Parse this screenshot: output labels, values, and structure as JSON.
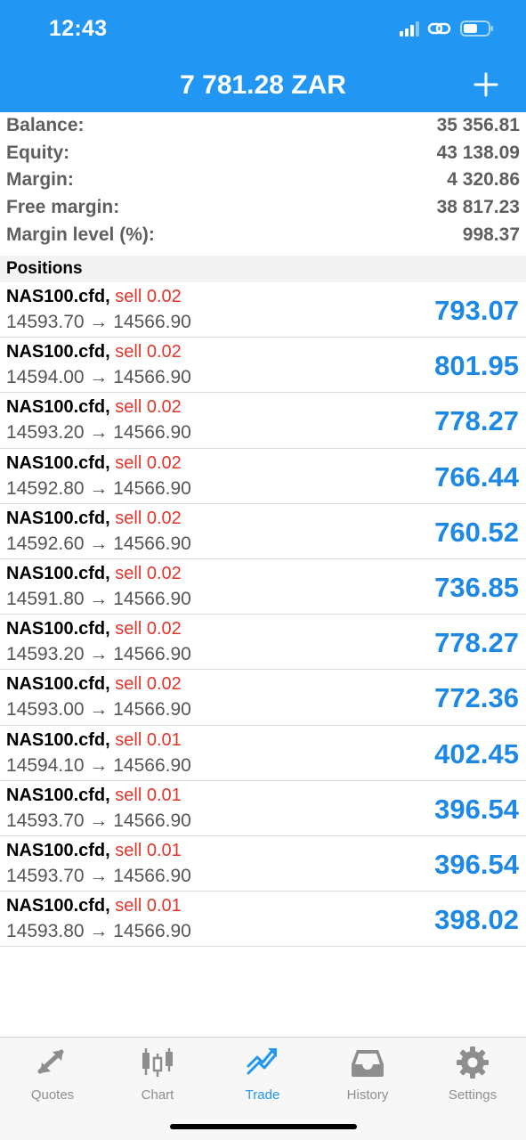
{
  "status_bar": {
    "time": "12:43"
  },
  "header": {
    "title": "7 781.28 ZAR",
    "add_icon": "plus-icon"
  },
  "summary": [
    {
      "label": "Balance:",
      "value": "35 356.81"
    },
    {
      "label": "Equity:",
      "value": "43 138.09"
    },
    {
      "label": "Margin:",
      "value": "4 320.86"
    },
    {
      "label": "Free margin:",
      "value": "38 817.23"
    },
    {
      "label": "Margin level (%):",
      "value": "998.37"
    }
  ],
  "positions_title": "Positions",
  "positions": [
    {
      "symbol": "NAS100.cfd,",
      "type": "sell 0.02",
      "prices": "14593.70 → 14566.90",
      "profit": "793.07"
    },
    {
      "symbol": "NAS100.cfd,",
      "type": "sell 0.02",
      "prices": "14594.00 → 14566.90",
      "profit": "801.95"
    },
    {
      "symbol": "NAS100.cfd,",
      "type": "sell 0.02",
      "prices": "14593.20 → 14566.90",
      "profit": "778.27"
    },
    {
      "symbol": "NAS100.cfd,",
      "type": "sell 0.02",
      "prices": "14592.80 → 14566.90",
      "profit": "766.44"
    },
    {
      "symbol": "NAS100.cfd,",
      "type": "sell 0.02",
      "prices": "14592.60 → 14566.90",
      "profit": "760.52"
    },
    {
      "symbol": "NAS100.cfd,",
      "type": "sell 0.02",
      "prices": "14591.80 → 14566.90",
      "profit": "736.85"
    },
    {
      "symbol": "NAS100.cfd,",
      "type": "sell 0.02",
      "prices": "14593.20 → 14566.90",
      "profit": "778.27"
    },
    {
      "symbol": "NAS100.cfd,",
      "type": "sell 0.02",
      "prices": "14593.00 → 14566.90",
      "profit": "772.36"
    },
    {
      "symbol": "NAS100.cfd,",
      "type": "sell 0.01",
      "prices": "14594.10 → 14566.90",
      "profit": "402.45"
    },
    {
      "symbol": "NAS100.cfd,",
      "type": "sell 0.01",
      "prices": "14593.70 → 14566.90",
      "profit": "396.54"
    },
    {
      "symbol": "NAS100.cfd,",
      "type": "sell 0.01",
      "prices": "14593.70 → 14566.90",
      "profit": "396.54"
    },
    {
      "symbol": "NAS100.cfd,",
      "type": "sell 0.01",
      "prices": "14593.80 → 14566.90",
      "profit": "398.02"
    }
  ],
  "tabs": [
    {
      "label": "Quotes",
      "icon": "quotes-icon",
      "active": false
    },
    {
      "label": "Chart",
      "icon": "chart-icon",
      "active": false
    },
    {
      "label": "Trade",
      "icon": "trade-icon",
      "active": true
    },
    {
      "label": "History",
      "icon": "history-icon",
      "active": false
    },
    {
      "label": "Settings",
      "icon": "settings-icon",
      "active": false
    }
  ],
  "colors": {
    "header_bg": "#2196f3",
    "sell": "#e0362c",
    "profit": "#1e88e5",
    "tab_active": "#2196f3",
    "tab_inactive": "#8e8e8e"
  }
}
